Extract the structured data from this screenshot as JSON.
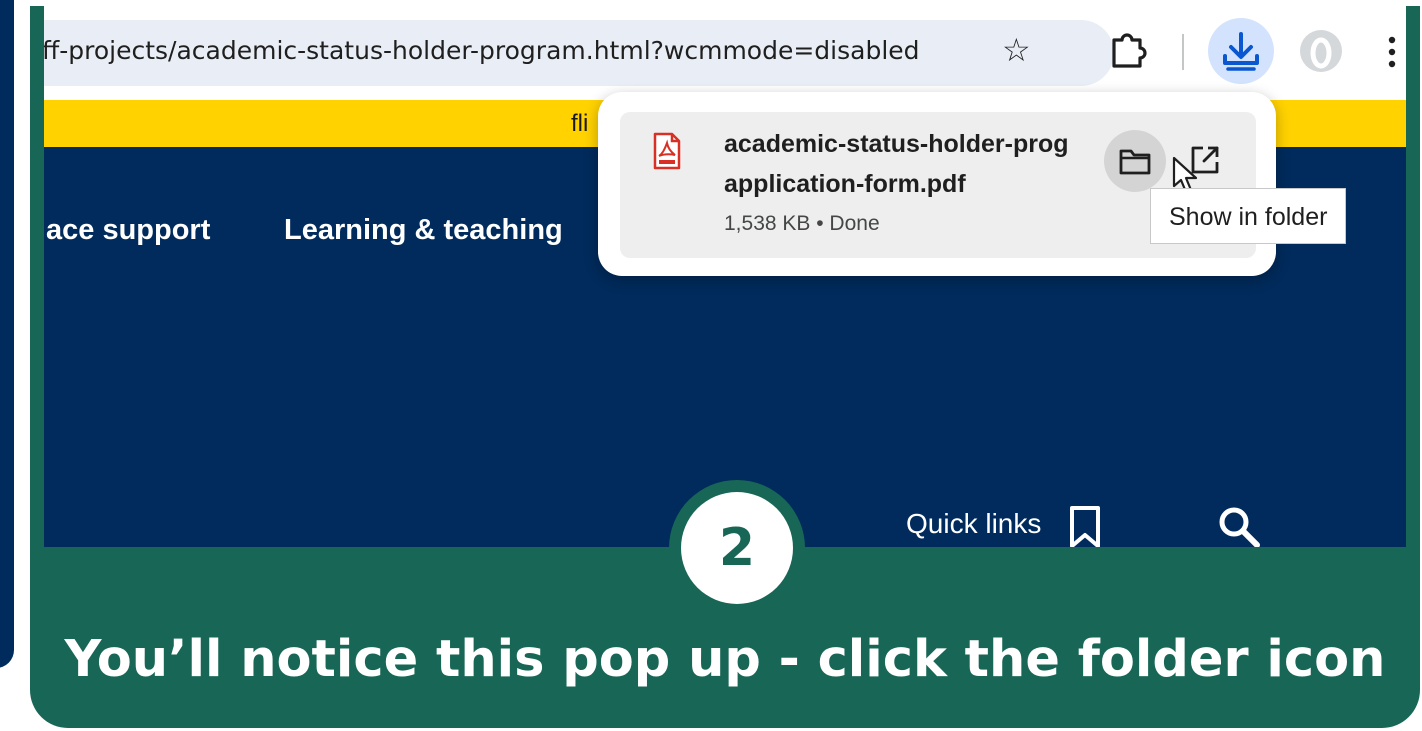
{
  "browser": {
    "url": "ff-projects/academic-status-holder-program.html?wcmmode=disabled",
    "star_glyph": "☆",
    "icons": [
      "star-icon",
      "extensions-icon",
      "download-icon",
      "profile-icon",
      "menu-icon"
    ],
    "accent_color": "#0b57d0"
  },
  "site": {
    "banner_text": "fli",
    "banner_color": "#ffd200",
    "background_color": "#002b5c",
    "nav": [
      "ace support",
      "Learning & teaching"
    ],
    "quick_links": "Quick links",
    "icons": [
      "bookmark-icon",
      "search-icon"
    ]
  },
  "download": {
    "filename_line1": "academic-status-holder-prog",
    "filename_line2": "application-form.pdf",
    "meta": "1,538 KB • Done",
    "tooltip": "Show in folder",
    "icons": [
      "pdf-file-icon",
      "folder-icon",
      "open-external-icon",
      "cursor-icon"
    ]
  },
  "step": {
    "number": "2",
    "caption": "You’ll notice this pop up - click the folder icon",
    "color": "#186756"
  }
}
